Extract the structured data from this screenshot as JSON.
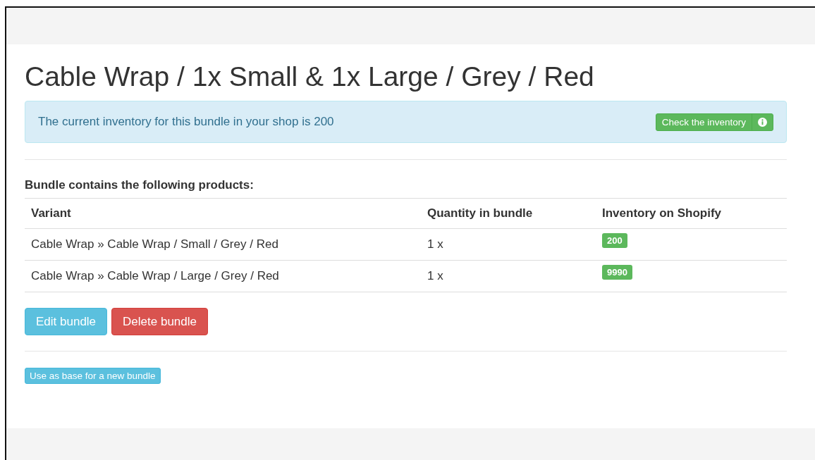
{
  "title": "Cable Wrap / 1x Small & 1x Large / Grey / Red",
  "alert": {
    "text": "The current inventory for this bundle in your shop is 200",
    "button": "Check the inventory"
  },
  "section_title": "Bundle contains the following products:",
  "table": {
    "columns": [
      "Variant",
      "Quantity in bundle",
      "Inventory on Shopify"
    ],
    "rows": [
      {
        "variant": "Cable Wrap » Cable Wrap / Small / Grey / Red",
        "quantity": "1 x",
        "inventory": "200"
      },
      {
        "variant": "Cable Wrap » Cable Wrap / Large / Grey / Red",
        "quantity": "1 x",
        "inventory": "9990"
      }
    ]
  },
  "actions": [
    {
      "label": "Edit bundle",
      "kind": "info"
    },
    {
      "label": "Delete bundle",
      "kind": "danger"
    }
  ],
  "base_button": "Use as base for a new bundle"
}
